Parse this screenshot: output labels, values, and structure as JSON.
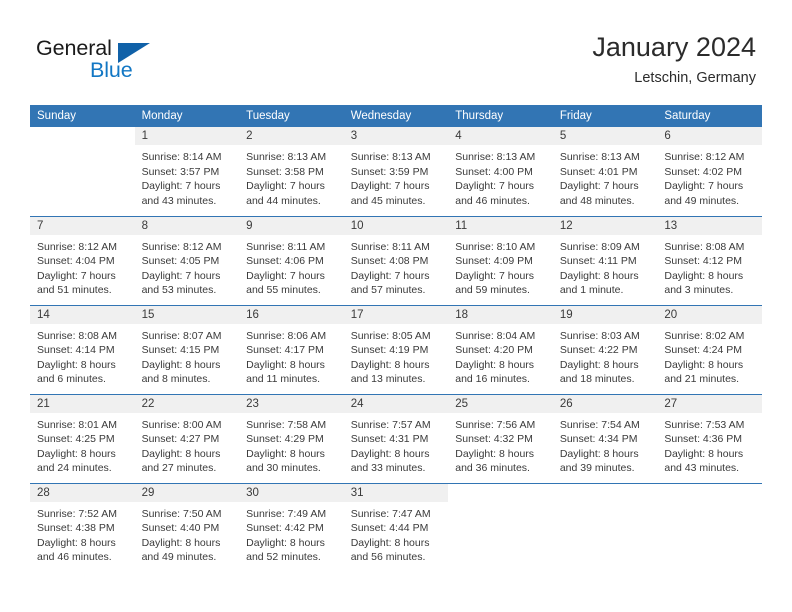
{
  "brand": {
    "name_part1": "General",
    "name_part2": "Blue",
    "triangle_color": "#1061a8",
    "blue_color": "#1277c4"
  },
  "header": {
    "title": "January 2024",
    "subtitle": "Letschin, Germany"
  },
  "theme": {
    "header_row_bg": "#3275b4",
    "daynum_bg": "#f0f0f0",
    "separator": "#3275b4",
    "text": "#3a3a3a"
  },
  "weekday_headers": [
    "Sunday",
    "Monday",
    "Tuesday",
    "Wednesday",
    "Thursday",
    "Friday",
    "Saturday"
  ],
  "labels": {
    "sunrise_prefix": "Sunrise:",
    "sunset_prefix": "Sunset:",
    "daylight_prefix": "Daylight:"
  },
  "weeks": [
    [
      {
        "day": "",
        "sunrise": "",
        "sunset": "",
        "daylight_line1": "",
        "daylight_line2": "",
        "empty": true
      },
      {
        "day": "1",
        "sunrise": "Sunrise: 8:14 AM",
        "sunset": "Sunset: 3:57 PM",
        "daylight_line1": "Daylight: 7 hours",
        "daylight_line2": "and 43 minutes."
      },
      {
        "day": "2",
        "sunrise": "Sunrise: 8:13 AM",
        "sunset": "Sunset: 3:58 PM",
        "daylight_line1": "Daylight: 7 hours",
        "daylight_line2": "and 44 minutes."
      },
      {
        "day": "3",
        "sunrise": "Sunrise: 8:13 AM",
        "sunset": "Sunset: 3:59 PM",
        "daylight_line1": "Daylight: 7 hours",
        "daylight_line2": "and 45 minutes."
      },
      {
        "day": "4",
        "sunrise": "Sunrise: 8:13 AM",
        "sunset": "Sunset: 4:00 PM",
        "daylight_line1": "Daylight: 7 hours",
        "daylight_line2": "and 46 minutes."
      },
      {
        "day": "5",
        "sunrise": "Sunrise: 8:13 AM",
        "sunset": "Sunset: 4:01 PM",
        "daylight_line1": "Daylight: 7 hours",
        "daylight_line2": "and 48 minutes."
      },
      {
        "day": "6",
        "sunrise": "Sunrise: 8:12 AM",
        "sunset": "Sunset: 4:02 PM",
        "daylight_line1": "Daylight: 7 hours",
        "daylight_line2": "and 49 minutes."
      }
    ],
    [
      {
        "day": "7",
        "sunrise": "Sunrise: 8:12 AM",
        "sunset": "Sunset: 4:04 PM",
        "daylight_line1": "Daylight: 7 hours",
        "daylight_line2": "and 51 minutes."
      },
      {
        "day": "8",
        "sunrise": "Sunrise: 8:12 AM",
        "sunset": "Sunset: 4:05 PM",
        "daylight_line1": "Daylight: 7 hours",
        "daylight_line2": "and 53 minutes."
      },
      {
        "day": "9",
        "sunrise": "Sunrise: 8:11 AM",
        "sunset": "Sunset: 4:06 PM",
        "daylight_line1": "Daylight: 7 hours",
        "daylight_line2": "and 55 minutes."
      },
      {
        "day": "10",
        "sunrise": "Sunrise: 8:11 AM",
        "sunset": "Sunset: 4:08 PM",
        "daylight_line1": "Daylight: 7 hours",
        "daylight_line2": "and 57 minutes."
      },
      {
        "day": "11",
        "sunrise": "Sunrise: 8:10 AM",
        "sunset": "Sunset: 4:09 PM",
        "daylight_line1": "Daylight: 7 hours",
        "daylight_line2": "and 59 minutes."
      },
      {
        "day": "12",
        "sunrise": "Sunrise: 8:09 AM",
        "sunset": "Sunset: 4:11 PM",
        "daylight_line1": "Daylight: 8 hours",
        "daylight_line2": "and 1 minute."
      },
      {
        "day": "13",
        "sunrise": "Sunrise: 8:08 AM",
        "sunset": "Sunset: 4:12 PM",
        "daylight_line1": "Daylight: 8 hours",
        "daylight_line2": "and 3 minutes."
      }
    ],
    [
      {
        "day": "14",
        "sunrise": "Sunrise: 8:08 AM",
        "sunset": "Sunset: 4:14 PM",
        "daylight_line1": "Daylight: 8 hours",
        "daylight_line2": "and 6 minutes."
      },
      {
        "day": "15",
        "sunrise": "Sunrise: 8:07 AM",
        "sunset": "Sunset: 4:15 PM",
        "daylight_line1": "Daylight: 8 hours",
        "daylight_line2": "and 8 minutes."
      },
      {
        "day": "16",
        "sunrise": "Sunrise: 8:06 AM",
        "sunset": "Sunset: 4:17 PM",
        "daylight_line1": "Daylight: 8 hours",
        "daylight_line2": "and 11 minutes."
      },
      {
        "day": "17",
        "sunrise": "Sunrise: 8:05 AM",
        "sunset": "Sunset: 4:19 PM",
        "daylight_line1": "Daylight: 8 hours",
        "daylight_line2": "and 13 minutes."
      },
      {
        "day": "18",
        "sunrise": "Sunrise: 8:04 AM",
        "sunset": "Sunset: 4:20 PM",
        "daylight_line1": "Daylight: 8 hours",
        "daylight_line2": "and 16 minutes."
      },
      {
        "day": "19",
        "sunrise": "Sunrise: 8:03 AM",
        "sunset": "Sunset: 4:22 PM",
        "daylight_line1": "Daylight: 8 hours",
        "daylight_line2": "and 18 minutes."
      },
      {
        "day": "20",
        "sunrise": "Sunrise: 8:02 AM",
        "sunset": "Sunset: 4:24 PM",
        "daylight_line1": "Daylight: 8 hours",
        "daylight_line2": "and 21 minutes."
      }
    ],
    [
      {
        "day": "21",
        "sunrise": "Sunrise: 8:01 AM",
        "sunset": "Sunset: 4:25 PM",
        "daylight_line1": "Daylight: 8 hours",
        "daylight_line2": "and 24 minutes."
      },
      {
        "day": "22",
        "sunrise": "Sunrise: 8:00 AM",
        "sunset": "Sunset: 4:27 PM",
        "daylight_line1": "Daylight: 8 hours",
        "daylight_line2": "and 27 minutes."
      },
      {
        "day": "23",
        "sunrise": "Sunrise: 7:58 AM",
        "sunset": "Sunset: 4:29 PM",
        "daylight_line1": "Daylight: 8 hours",
        "daylight_line2": "and 30 minutes."
      },
      {
        "day": "24",
        "sunrise": "Sunrise: 7:57 AM",
        "sunset": "Sunset: 4:31 PM",
        "daylight_line1": "Daylight: 8 hours",
        "daylight_line2": "and 33 minutes."
      },
      {
        "day": "25",
        "sunrise": "Sunrise: 7:56 AM",
        "sunset": "Sunset: 4:32 PM",
        "daylight_line1": "Daylight: 8 hours",
        "daylight_line2": "and 36 minutes."
      },
      {
        "day": "26",
        "sunrise": "Sunrise: 7:54 AM",
        "sunset": "Sunset: 4:34 PM",
        "daylight_line1": "Daylight: 8 hours",
        "daylight_line2": "and 39 minutes."
      },
      {
        "day": "27",
        "sunrise": "Sunrise: 7:53 AM",
        "sunset": "Sunset: 4:36 PM",
        "daylight_line1": "Daylight: 8 hours",
        "daylight_line2": "and 43 minutes."
      }
    ],
    [
      {
        "day": "28",
        "sunrise": "Sunrise: 7:52 AM",
        "sunset": "Sunset: 4:38 PM",
        "daylight_line1": "Daylight: 8 hours",
        "daylight_line2": "and 46 minutes."
      },
      {
        "day": "29",
        "sunrise": "Sunrise: 7:50 AM",
        "sunset": "Sunset: 4:40 PM",
        "daylight_line1": "Daylight: 8 hours",
        "daylight_line2": "and 49 minutes."
      },
      {
        "day": "30",
        "sunrise": "Sunrise: 7:49 AM",
        "sunset": "Sunset: 4:42 PM",
        "daylight_line1": "Daylight: 8 hours",
        "daylight_line2": "and 52 minutes."
      },
      {
        "day": "31",
        "sunrise": "Sunrise: 7:47 AM",
        "sunset": "Sunset: 4:44 PM",
        "daylight_line1": "Daylight: 8 hours",
        "daylight_line2": "and 56 minutes."
      },
      {
        "day": "",
        "sunrise": "",
        "sunset": "",
        "daylight_line1": "",
        "daylight_line2": "",
        "empty": true
      },
      {
        "day": "",
        "sunrise": "",
        "sunset": "",
        "daylight_line1": "",
        "daylight_line2": "",
        "empty": true
      },
      {
        "day": "",
        "sunrise": "",
        "sunset": "",
        "daylight_line1": "",
        "daylight_line2": "",
        "empty": true
      }
    ]
  ]
}
